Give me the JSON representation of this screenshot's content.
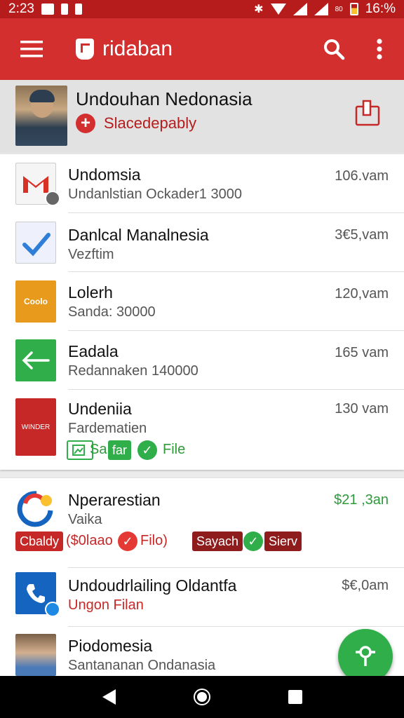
{
  "status_bar": {
    "time": "2:23",
    "sim_label": "80",
    "battery": "16:%"
  },
  "app_bar": {
    "title": "ridaban"
  },
  "account": {
    "name": "Undouhan Nedonasia",
    "subtitle": "Slacedepably"
  },
  "list1": [
    {
      "title": "Undomsia",
      "subtitle": "Undanlstian Ockader1 3000",
      "time": "106.vam"
    },
    {
      "title": "Danlcal Manalnesia",
      "subtitle": "Vezftim",
      "time": "3€5,vam"
    },
    {
      "title": "Lolerh",
      "subtitle": "Sanda: 30000",
      "time": "120,vam",
      "icon_text": "Coolo"
    },
    {
      "title": "Eadala",
      "subtitle": "Redannaken 140000",
      "time": "165 vam"
    },
    {
      "title": "Undeniia",
      "subtitle": "Fardematien",
      "time": "130 vam",
      "icon_text": "WINDER",
      "tags": {
        "t1": "Sa",
        "t2": "far",
        "t3": "File"
      }
    }
  ],
  "list2": [
    {
      "title": "Nperarestian",
      "subtitle": "Vaika",
      "time": "$21 ,3an",
      "tags": {
        "t1": "Cbaldy",
        "t2": "($0laao",
        "t3": "Filo)",
        "t4": "Sayach",
        "t5": "Sierv"
      }
    },
    {
      "title": "Undoudrlailing Oldantfa",
      "subtitle": "Ungon Filan",
      "time": "$€,0am"
    },
    {
      "title": "Piodomesia",
      "subtitle": "Santananan Ondanasia",
      "time": "3"
    }
  ],
  "colors": {
    "primary": "#d32f2f",
    "dark_primary": "#b71c1c",
    "accent_green": "#2fae4a"
  },
  "icons": {
    "menu": "menu-icon",
    "search": "search-icon",
    "more": "more-vert-icon",
    "export": "export-icon",
    "fab": "key-icon"
  }
}
